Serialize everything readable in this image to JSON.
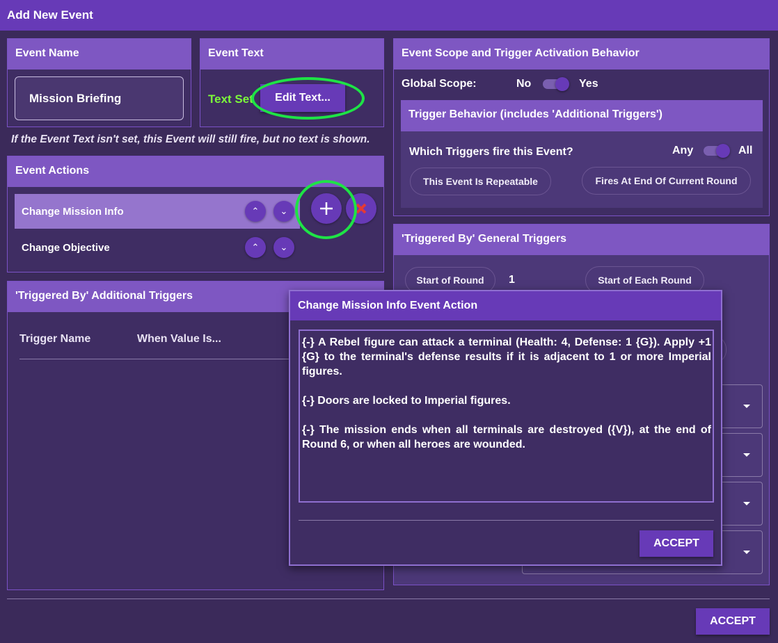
{
  "window": {
    "title": "Add New Event"
  },
  "event_name": {
    "header": "Event Name",
    "value": "Mission Briefing"
  },
  "event_text": {
    "header": "Event Text",
    "status": "Text Set",
    "edit_button": "Edit Text..."
  },
  "hint": "If the Event Text isn't set, this Event will still fire, but no text is shown.",
  "event_actions": {
    "header": "Event Actions",
    "items": [
      {
        "label": "Change Mission Info",
        "selected": true
      },
      {
        "label": "Change Objective",
        "selected": false
      }
    ],
    "add_icon": "plus-icon",
    "delete_icon": "close-icon"
  },
  "scope": {
    "header": "Event Scope and Trigger Activation Behavior",
    "global_label": "Global Scope:",
    "no": "No",
    "yes": "Yes",
    "global_on": true,
    "trigger_behavior": {
      "header": "Trigger Behavior (includes 'Additional Triggers')",
      "question": "Which Triggers fire this Event?",
      "any": "Any",
      "all": "All",
      "repeatable": "This Event Is Repeatable",
      "end_of_round": "Fires At End Of Current Round"
    }
  },
  "general_triggers": {
    "header": "'Triggered By' General Triggers",
    "start_of_round": "Start of Round",
    "round_value": "1",
    "start_of_each_round": "Start of Each Round"
  },
  "additional_triggers": {
    "header": "'Triggered By' Additional Triggers",
    "col_name": "Trigger Name",
    "col_value": "When Value Is..."
  },
  "dialog": {
    "title": "Change Mission Info Event Action",
    "text_lines": [
      "{-} A Rebel figure can attack a terminal (Health: 4, Defense: 1 {G}). Apply +1 {G} to the terminal's defense results if it is adjacent to 1 or more Imperial figures.",
      "",
      "{-} Doors are locked to Imperial figures.",
      "",
      "{-} The mission ends when all terminals are destroyed ({V}), at the end of Round 6, or when all heroes are wounded."
    ],
    "accept": "ACCEPT"
  },
  "accept": "ACCEPT",
  "colors": {
    "accent": "#673ab7",
    "header": "#7e57c2",
    "panel": "#3f2d63",
    "status_green": "#7cfc3a",
    "highlight_ring": "#1ee346",
    "delete_red": "#e53935"
  }
}
